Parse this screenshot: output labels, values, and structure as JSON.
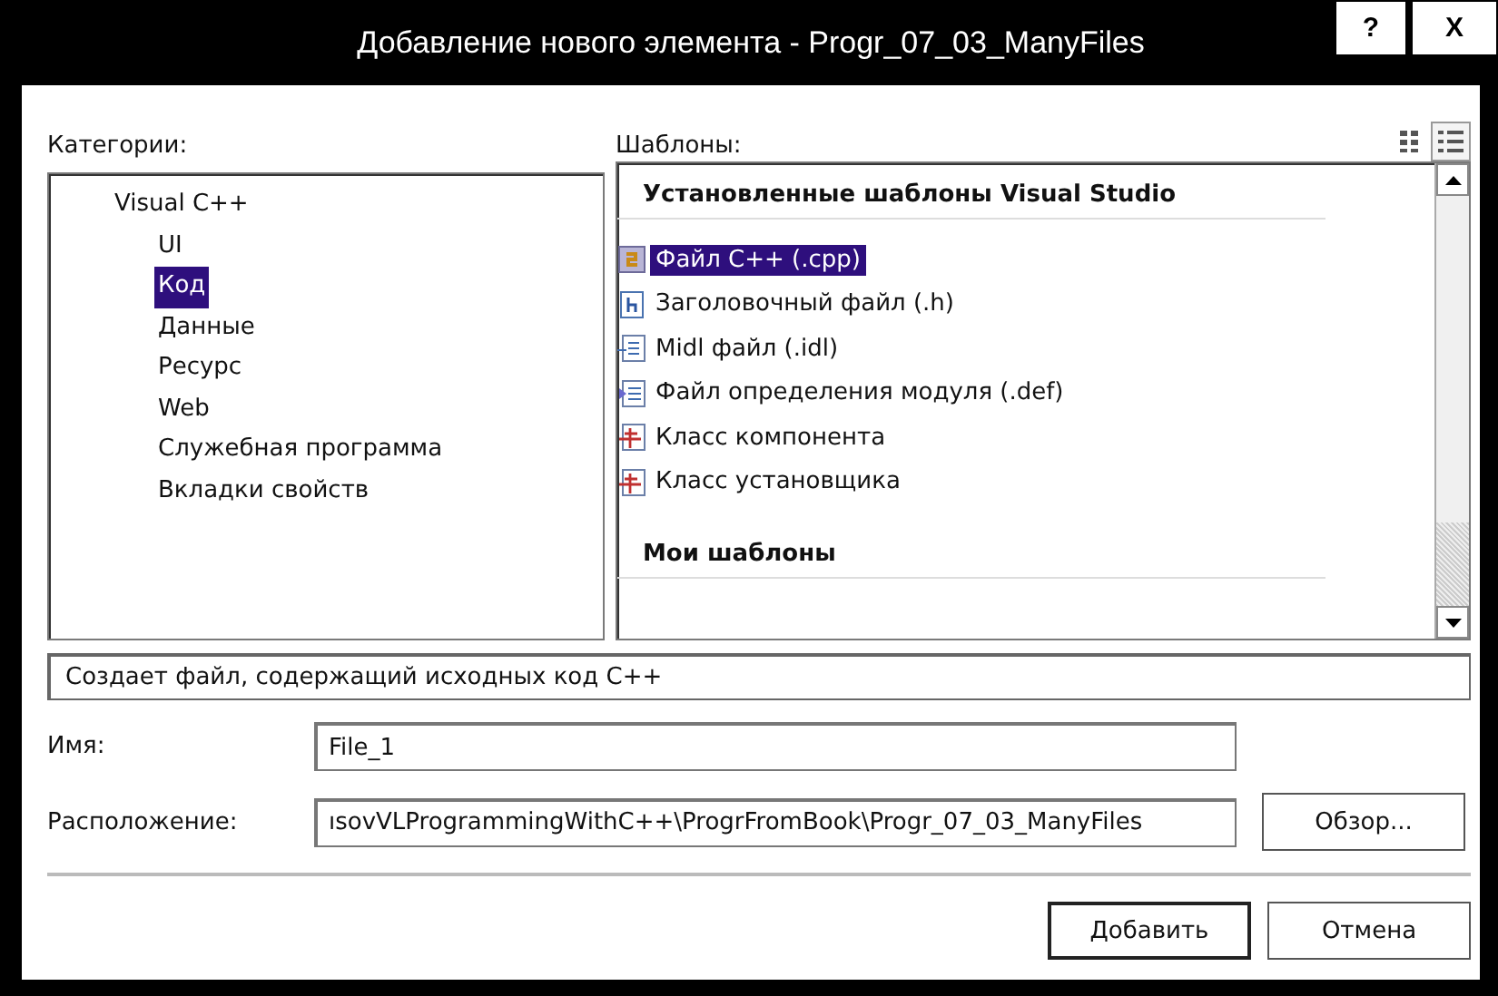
{
  "window": {
    "title": "Добавление нового элемента - Progr_07_03_ManyFiles",
    "help_button": "?",
    "close_button": "X"
  },
  "categories": {
    "label": "Категории:",
    "items": [
      {
        "label": "Visual C++",
        "selected": false,
        "children": [
          {
            "label": "UI",
            "selected": false
          },
          {
            "label": "Код",
            "selected": true
          },
          {
            "label": "Данные",
            "selected": false
          },
          {
            "label": "Ресурс",
            "selected": false
          },
          {
            "label": "Web",
            "selected": false
          },
          {
            "label": "Служебная программа",
            "selected": false
          },
          {
            "label": "Вкладки свойств",
            "selected": false
          }
        ]
      }
    ]
  },
  "templates": {
    "label": "Шаблоны:",
    "groups": [
      {
        "heading": "Установленные шаблоны Visual Studio",
        "items": [
          {
            "label": "Файл C++ (.cpp)",
            "kind": "cpp",
            "selected": true
          },
          {
            "label": "Заголовочный файл (.h)",
            "kind": "header",
            "selected": false
          },
          {
            "label": "Midl файл (.idl)",
            "kind": "idl",
            "selected": false
          },
          {
            "label": "Файл определения модуля (.def)",
            "kind": "def",
            "selected": false
          },
          {
            "label": "Класс компонента",
            "kind": "class",
            "selected": false
          },
          {
            "label": "Класс установщика",
            "kind": "class",
            "selected": false
          }
        ]
      },
      {
        "heading": "Мои шаблоны"
      }
    ]
  },
  "description": "Создает файл, содержащий исходных код C++",
  "name_field": {
    "label": "Имя:",
    "value": "File_1"
  },
  "location_field": {
    "label": "Расположение:",
    "value": "ısovVLProgrammingWithC++\\ProgrFromBook\\Progr_07_03_ManyFiles",
    "browse_button": "Обзор..."
  },
  "buttons": [
    {
      "label": "Добавить",
      "default": true
    },
    {
      "label": "Отмена",
      "default": false
    }
  ]
}
